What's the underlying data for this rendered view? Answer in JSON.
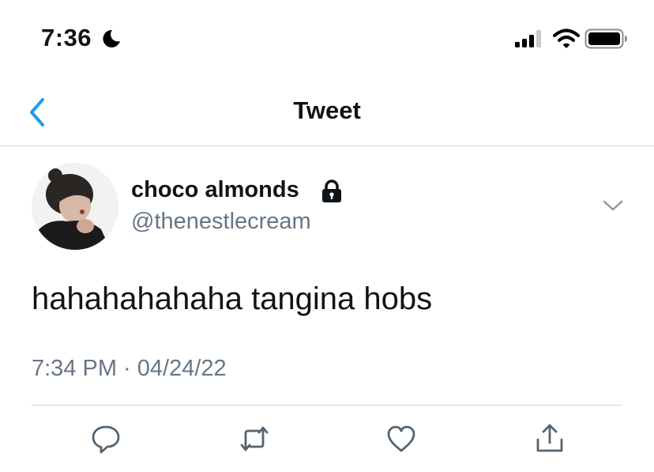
{
  "status_bar": {
    "time": "7:36",
    "icons": [
      "moon-icon",
      "signal-icon",
      "wifi-icon",
      "battery-icon"
    ]
  },
  "nav": {
    "title": "Tweet",
    "back_icon": "chevron-left-icon"
  },
  "tweet": {
    "author": {
      "display_name": "choco almonds",
      "handle": "@thenestlecream",
      "protected_icon": "lock-icon"
    },
    "text": "hahahahahaha tangina hobs",
    "meta": "7:34 PM · 04/24/22",
    "actions": [
      "reply-icon",
      "retweet-icon",
      "like-icon",
      "share-icon"
    ]
  },
  "colors": {
    "accent": "#1d9bf0",
    "text_primary": "#0f1419",
    "text_secondary": "#687684",
    "divider": "#d3d6d9"
  }
}
